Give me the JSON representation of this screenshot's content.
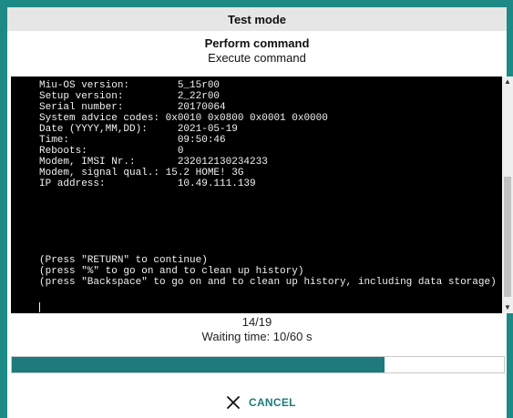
{
  "window": {
    "title": "Test mode"
  },
  "header": {
    "title": "Perform command",
    "subtitle": "Execute command"
  },
  "console": {
    "lines": [
      "Miu-OS version:        5_15r00",
      "Setup version:         2_22r00",
      "Serial number:         20170064",
      "System advice codes: 0x0010 0x0800 0x0001 0x0000",
      "Date (YYYY,MM,DD):     2021-05-19",
      "Time:                  09:50:46",
      "Reboots:               0",
      "Modem, IMSI Nr.:       232012130234233",
      "Modem, signal qual.: 15.2 HOME! 3G",
      "IP address:            10.49.111.139",
      "",
      "",
      "",
      "",
      "",
      "",
      "(Press \"RETURN\" to continue)",
      "(press \"%\" to go on and to clean up history)",
      "(press \"Backspace\" to go on and to clean up history, including data storage)"
    ]
  },
  "status": {
    "step": "14/19",
    "waiting": "Waiting time: 10/60 s"
  },
  "progress": {
    "fraction": 0.7583,
    "color": "#1e7a7c"
  },
  "actions": {
    "cancel_label": "CANCEL",
    "cancel_icon": "close-icon"
  },
  "colors": {
    "accent": "#1e8a85",
    "console_bg": "#000000",
    "console_fg": "#f2f2f2"
  }
}
